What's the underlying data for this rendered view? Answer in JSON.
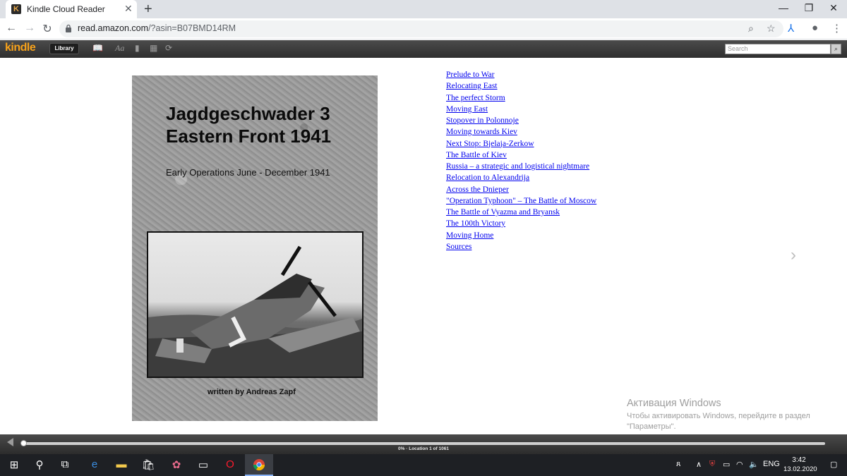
{
  "browser": {
    "tab_title": "Kindle Cloud Reader",
    "tab_favicon": "K",
    "url_host": "read.amazon.com",
    "url_path": "/?asin=B07BMD14RM"
  },
  "kindle_toolbar": {
    "logo": "kindle",
    "library_label": "Library",
    "font_label": "Aa",
    "search_placeholder": "Search"
  },
  "book": {
    "cover_title_line1": "Jagdgeschwader 3",
    "cover_title_line2": "Eastern Front 1941",
    "cover_subtitle": "Early Operations June - December 1941",
    "cover_author": "written by Andreas Zapf"
  },
  "toc": [
    "Prelude to War",
    "Relocating East",
    "The perfect Storm",
    "Moving East",
    "Stopover in Polonnoje",
    "Moving towards Kiev",
    "Next Stop: Bjelaja-Zerkow",
    "The Battle of Kiev",
    "Russia – a strategic and logistical nightmare",
    "Relocation to Alexandrija",
    "Across the Dnieper",
    "\"Operation Typhoon\" – The Battle of Moscow",
    "The Battle of Vyazma and Bryansk",
    "The 100th Victory",
    "Moving Home",
    "Sources"
  ],
  "progress": {
    "fraction": 0.0,
    "label": "0% · Location 1 of 1061"
  },
  "watermark": {
    "title": "Активация Windows",
    "line1": "Чтобы активировать Windows, перейдите в раздел",
    "line2": "\"Параметры\"."
  },
  "taskbar": {
    "language": "ENG",
    "time": "3:42",
    "date": "13.02.2020"
  },
  "colors": {
    "kindle_orange": "#f7a21b",
    "link_blue": "#0000ee",
    "toolbar_dark": "#2f2f2f"
  }
}
